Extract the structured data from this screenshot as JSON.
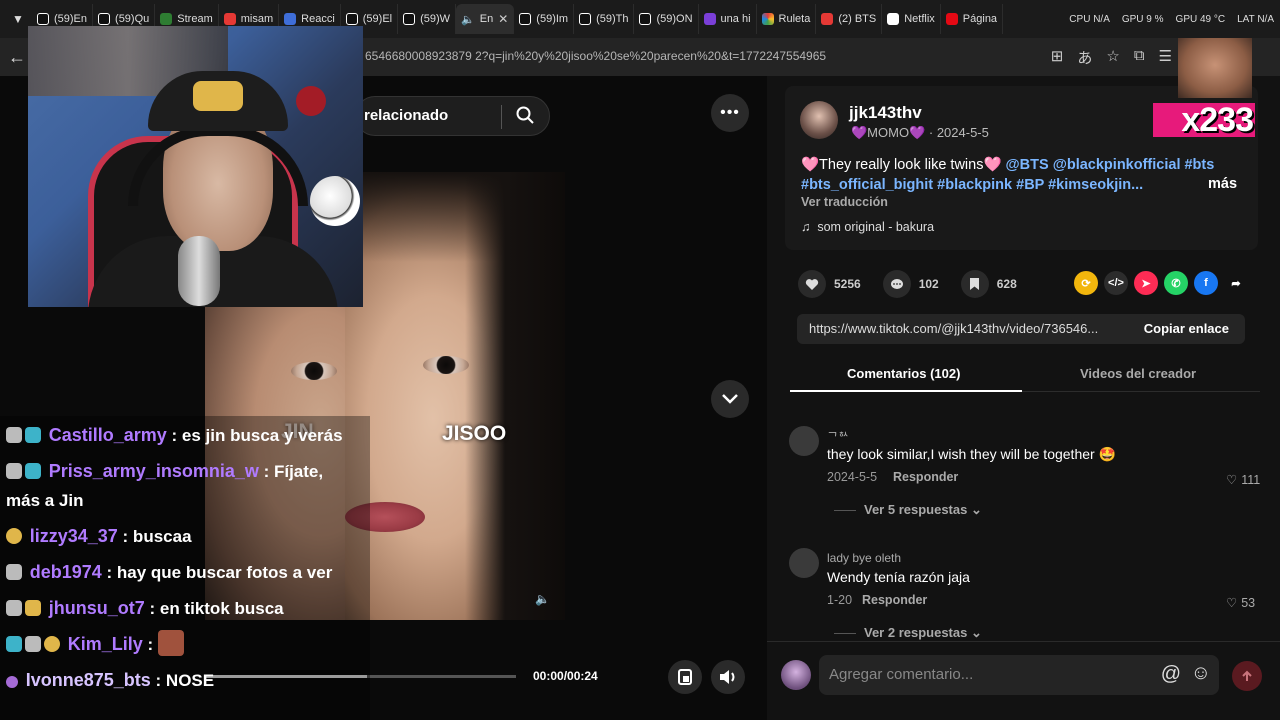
{
  "browser": {
    "tabs": [
      {
        "label": "(59)En",
        "color": "#111111"
      },
      {
        "label": "(59)Qu",
        "color": "#111111"
      },
      {
        "label": "Stream",
        "color": "#2e7d32"
      },
      {
        "label": "misam",
        "color": "#e53935"
      },
      {
        "label": "Reacci",
        "color": "#3f6ed8"
      },
      {
        "label": "(59)El",
        "color": "#111111"
      },
      {
        "label": "(59)W",
        "color": "#111111"
      },
      {
        "label": "En",
        "color": "#111111"
      },
      {
        "label": "(59)Im",
        "color": "#111111"
      },
      {
        "label": "(59)Th",
        "color": "#111111"
      },
      {
        "label": "(59)ON",
        "color": "#111111"
      },
      {
        "label": "una hi",
        "color": "#7b3fd8"
      },
      {
        "label": "Ruleta",
        "color": "#e53935"
      },
      {
        "label": "(2) BTS",
        "color": "#e53935"
      },
      {
        "label": "Netflix",
        "color": "#e50914"
      },
      {
        "label": "Página",
        "color": "#c62828"
      }
    ],
    "sys": {
      "cpu": "CPU N/A",
      "gpu": "GPU 9 %",
      "gpu2": "GPU 49 °C",
      "lat": "LAT N/A"
    },
    "url": "6546680008923879 2?q=jin%20y%20jisoo%20se%20parecen%20&t=1772247554965"
  },
  "video": {
    "search_text": "relacionado",
    "label_left": "JIN",
    "label_right": "JISOO",
    "time": "00:00/00:24",
    "progress": 0.52
  },
  "chat": {
    "messages": [
      {
        "user": "Castillo_army",
        "text": ": es jin busca y verás",
        "color": "#b07bff"
      },
      {
        "user": "Priss_army_insomnia_w",
        "text": ": Fíjate,",
        "color": "#b07bff"
      },
      {
        "user": "",
        "text": "más a Jin",
        "color": "#ffffff"
      },
      {
        "user": "lizzy34_37",
        "text": ": buscaa",
        "color": "#b07bff"
      },
      {
        "user": "deb1974",
        "text": ": hay que buscar fotos a ver",
        "color": "#b07bff"
      },
      {
        "user": "jhunsu_ot7",
        "text": ": en tiktok busca",
        "color": "#b07bff"
      },
      {
        "user": "Kim_Lily",
        "text": ":",
        "color": "#b07bff"
      },
      {
        "user": "Ivonne875_bts",
        "text": ": NOSE",
        "color": "#d7c4ff"
      }
    ]
  },
  "overlay": {
    "counter": "x233"
  },
  "post": {
    "username": "jjk143thv",
    "nickname": "💜MOMO💜",
    "date": "2024-5-5",
    "desc_plain": "🩷They really look like twins🩷",
    "desc_tags_1": "@BTS @blackpinkofficial #bts",
    "desc_tags_2": "#bts_official_bighit #blackpink #BP #kimseokjin...",
    "more": "más",
    "translate": "Ver traducción",
    "music": "som original - bakura",
    "likes": "5256",
    "comments": "102",
    "saves": "628",
    "link": "https://www.tiktok.com/@jjk143thv/video/736546...",
    "copy": "Copiar enlace",
    "tab_comments": "Comentarios (102)",
    "tab_creator": "Videos del creador"
  },
  "comments": [
    {
      "user": "ᄀᄒᄉ",
      "text": "they look similar,I wish they will be together 🤩",
      "date": "2024-5-5",
      "reply": "Responder",
      "likes": "111",
      "more": "Ver 5 respuestas"
    },
    {
      "user": "lady bye oleth",
      "text": "Wendy tenía razón jaja",
      "date": "1-20",
      "reply": "Responder",
      "likes": "53",
      "more": "Ver 2 respuestas"
    }
  ],
  "composer": {
    "placeholder": "Agregar comentario..."
  }
}
